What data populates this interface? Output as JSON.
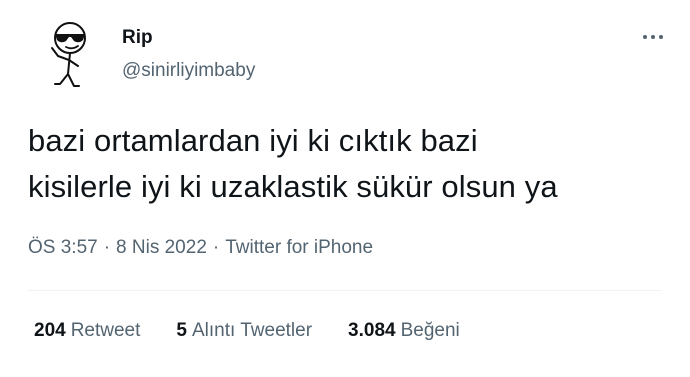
{
  "author": {
    "display_name": "Rip",
    "handle": "@sinirliyimbaby",
    "avatar_icon": "stick-figure-sunglasses-avatar"
  },
  "tweet": {
    "text": "bazi ortamlardan iyi ki cıktık bazi\nkisilerle iyi ki uzaklastik sükür olsun ya"
  },
  "meta": {
    "time": "ÖS 3:57",
    "separator": "·",
    "date": "8 Nis 2022",
    "source": "Twitter for iPhone"
  },
  "stats": {
    "retweets": {
      "count": "204",
      "label": "Retweet"
    },
    "quotes": {
      "count": "5",
      "label": "Alıntı Tweetler"
    },
    "likes": {
      "count": "3.084",
      "label": "Beğeni"
    }
  },
  "colors": {
    "text": "#0f1419",
    "secondary": "#536471",
    "divider": "#eff3f4"
  }
}
